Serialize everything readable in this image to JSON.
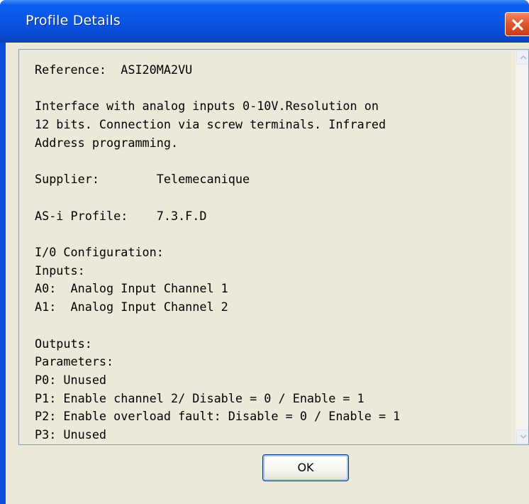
{
  "window": {
    "title": "Profile Details"
  },
  "details": {
    "lines": [
      "Reference:  ASI20MA2VU",
      "",
      "Interface with analog inputs 0-10V.Resolution on",
      "12 bits. Connection via screw terminals. Infrared",
      "Address programming.",
      "",
      "Supplier:        Telemecanique",
      "",
      "AS-i Profile:    7.3.F.D",
      "",
      "I/0 Configuration:",
      "Inputs:",
      "A0:  Analog Input Channel 1",
      "A1:  Analog Input Channel 2",
      "",
      "Outputs:",
      "Parameters:",
      "P0: Unused",
      "P1: Enable channel 2/ Disable = 0 / Enable = 1",
      "P2: Enable overload fault: Disable = 0 / Enable = 1",
      "P3: Unused"
    ]
  },
  "buttons": {
    "ok_label": "OK"
  },
  "icons": {
    "close": "close-icon",
    "scroll_up": "scroll-up-arrow-icon",
    "scroll_down": "scroll-down-arrow-icon"
  },
  "colors": {
    "titlebar": "#0a55e6",
    "close_button": "#e2582e",
    "dialog_background": "#ece9d8",
    "textbox_border": "#7f9db9"
  }
}
